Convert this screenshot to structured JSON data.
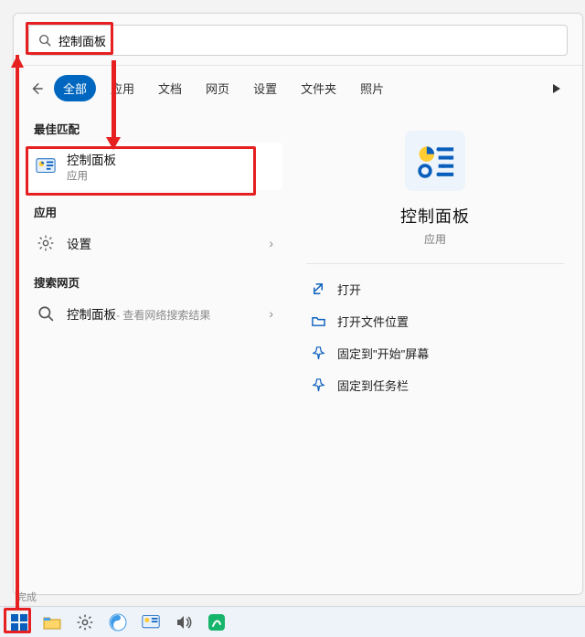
{
  "search": {
    "query": "控制面板"
  },
  "tabs": {
    "items": [
      "全部",
      "应用",
      "文档",
      "网页",
      "设置",
      "文件夹",
      "照片"
    ],
    "active_index": 0
  },
  "sections": {
    "best_match": "最佳匹配",
    "apps": "应用",
    "web": "搜索网页"
  },
  "best_result": {
    "title": "控制面板",
    "subtitle": "应用"
  },
  "app_result": {
    "title": "设置"
  },
  "web_result": {
    "title": "控制面板",
    "subtitle": " - 查看网络搜索结果"
  },
  "details": {
    "title": "控制面板",
    "subtitle": "应用",
    "actions": {
      "open": "打开",
      "open_location": "打开文件位置",
      "pin_start": "固定到\"开始\"屏幕",
      "pin_taskbar": "固定到任务栏"
    }
  },
  "status": "完成"
}
